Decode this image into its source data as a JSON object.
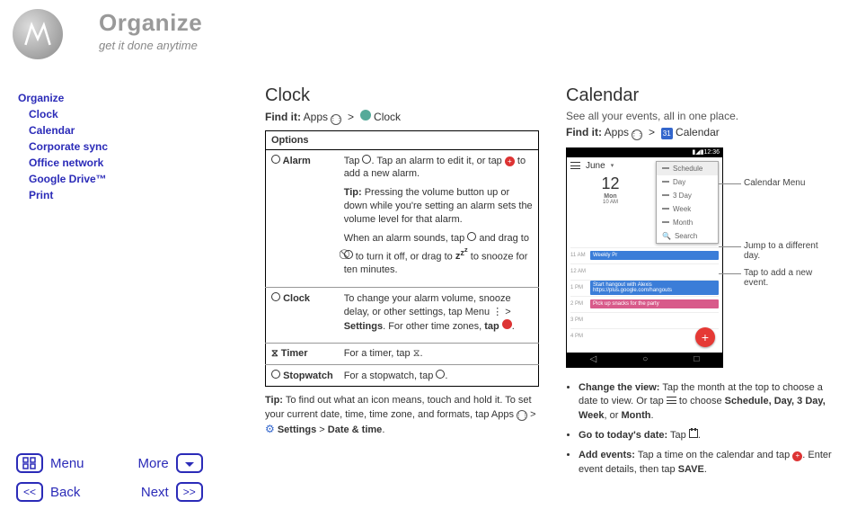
{
  "header": {
    "title": "Organize",
    "subtitle": "get it done anytime"
  },
  "toc": {
    "items": [
      {
        "label": "Organize",
        "level": 0
      },
      {
        "label": "Clock",
        "level": 1
      },
      {
        "label": "Calendar",
        "level": 1
      },
      {
        "label": "Corporate sync",
        "level": 1
      },
      {
        "label": "Office network",
        "level": 1
      },
      {
        "label": "Google Drive™",
        "level": 1
      },
      {
        "label": "Print",
        "level": 1
      }
    ]
  },
  "nav": {
    "menu": "Menu",
    "back": "Back",
    "more": "More",
    "next": "Next"
  },
  "clock": {
    "title": "Clock",
    "find_label": "Find it:",
    "find_prefix": "Apps",
    "find_suffix": "Clock",
    "table_header": "Options",
    "rows": {
      "alarm": {
        "label": "Alarm",
        "p1a": "Tap ",
        "p1b": ". Tap an alarm to edit it, or tap ",
        "p1c": " to add a new alarm.",
        "tip_label": "Tip:",
        "tip_text": " Pressing the volume button up or down while you're setting an alarm sets the volume level for that alarm.",
        "p3a": "When an alarm sounds, tap ",
        "p3b": " and drag to ",
        "p3c": " to turn it off, or drag to ",
        "p3_snooze": "z",
        "p3d": " to snooze for ten minutes."
      },
      "clock": {
        "label": "Clock",
        "p1": "To change your alarm volume, snooze delay, or other settings, tap Menu ",
        "p1_settings": "Settings",
        "p1b": ". For other time zones, ",
        "p1_tap": "tap"
      },
      "timer": {
        "label": "Timer",
        "text": "For a timer, tap "
      },
      "stopwatch": {
        "label": "Stopwatch",
        "text": "For a stopwatch, tap "
      }
    },
    "bottom_tip_label": "Tip:",
    "bottom_tip": " To find out what an icon means, touch and hold it. To set your current date, time, time zone, and formats, tap Apps ",
    "bottom_tip_settings": "Settings",
    "bottom_tip_datetime": "Date & time"
  },
  "calendar": {
    "title": "Calendar",
    "desc": "See all your events, all in one place.",
    "find_label": "Find it:",
    "find_prefix": "Apps",
    "find_suffix": "Calendar",
    "phone": {
      "status_time": "12:36",
      "month": "June",
      "date_num": "12",
      "date_day": "Mon",
      "date_time": "10 AM",
      "menu_items": [
        "Schedule",
        "Day",
        "3 Day",
        "Week",
        "Month",
        "Search"
      ],
      "rows": [
        "11 AM",
        "12 AM",
        "1 PM",
        "2 PM",
        "3 PM",
        "4 PM"
      ],
      "ev1": "Weekly Pr",
      "ev2_a": "Start hangout with Alexis",
      "ev2_b": "https://plus.google.com/hangouts",
      "ev3": "Pick up snacks for the party"
    },
    "callouts": {
      "menu": "Calendar Menu",
      "jump": "Jump to a different day.",
      "add": "Tap to add a new event."
    },
    "bullets": {
      "b1_label": "Change the view:",
      "b1_a": " Tap the month at the top to choose a date to view. Or tap ",
      "b1_b": " to choose ",
      "b1_opts": "Schedule, Day, 3 Day, Week",
      "b1_or": ", or ",
      "b1_month": "Month",
      "b2_label": "Go to today's date:",
      "b2": " Tap ",
      "b3_label": "Add events:",
      "b3_a": " Tap a time on the calendar and tap ",
      "b3_b": ". Enter event details, then tap ",
      "b3_save": "SAVE"
    }
  }
}
